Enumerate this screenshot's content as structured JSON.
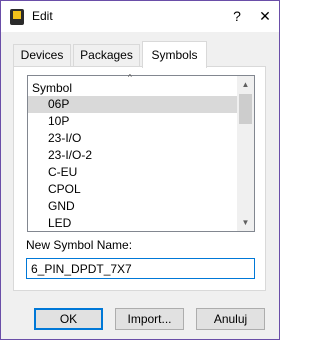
{
  "window": {
    "title": "Edit",
    "help_glyph": "?",
    "close_glyph": "✕"
  },
  "tabs": [
    {
      "label": "Devices",
      "active": false
    },
    {
      "label": "Packages",
      "active": false
    },
    {
      "label": "Symbols",
      "active": true
    }
  ],
  "symbol_list": {
    "column_header": "Symbol",
    "sort_glyph": "^",
    "items": [
      "06P",
      "10P",
      "23-I/O",
      "23-I/O-2",
      "C-EU",
      "CPOL",
      "GND",
      "LED"
    ],
    "selected_index": 0,
    "scroll_up_glyph": "▲",
    "scroll_down_glyph": "▼"
  },
  "new_name": {
    "label": "New Symbol Name:",
    "value": "6_PIN_DPDT_7X7"
  },
  "buttons": {
    "ok": "OK",
    "import": "Import...",
    "cancel": "Anuluj"
  },
  "colors": {
    "accent": "#0078d7",
    "window_border": "#6a4ea8",
    "selection": "#d9d9d9"
  }
}
